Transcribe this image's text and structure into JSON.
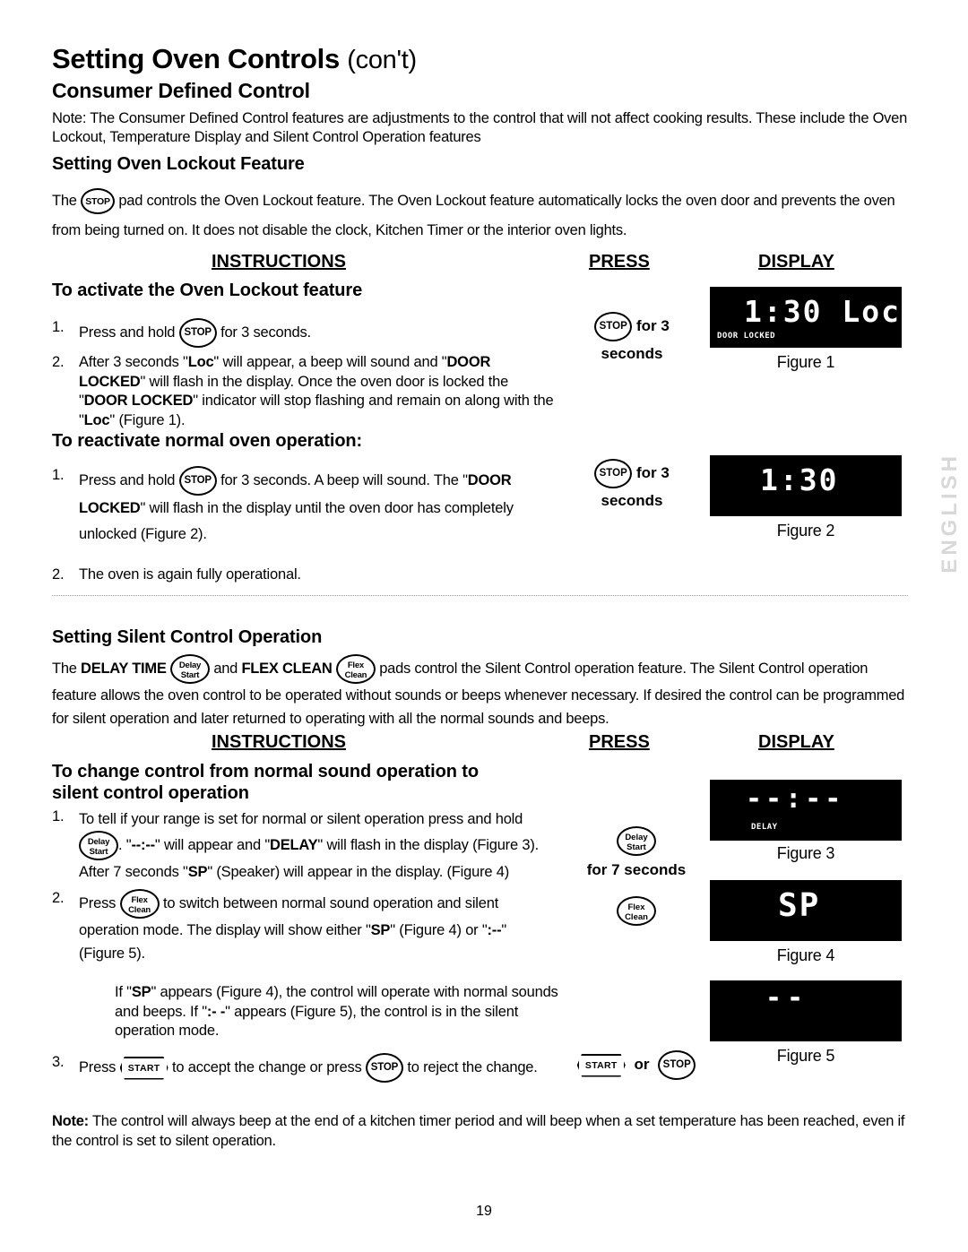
{
  "document": {
    "title_main": "Setting Oven Controls",
    "title_suffix": "(con't)",
    "subtitle": "Consumer Defined Control",
    "page_number": "19",
    "side_marker": "ENGLISH"
  },
  "intro": {
    "note": "Note: The Consumer Defined Control features are adjustments to the control that will not affect cooking results. These include the Oven Lockout, Temperature Display and Silent Control Operation features",
    "section_heading": "Setting Oven Lockout Feature",
    "paragraph_pre": "The",
    "paragraph_post": "pad controls the Oven Lockout feature. The Oven Lockout feature automatically locks the oven door and prevents the oven from being turned on. It does not disable the clock, Kitchen Timer or the interior oven lights."
  },
  "columns": {
    "instructions": "INSTRUCTIONS",
    "press": "PRESS",
    "display": "DISPLAY"
  },
  "pads": {
    "stop": "STOP",
    "start": "START",
    "delay_line1": "Delay",
    "delay_line2": "Start",
    "flex_line1": "Flex",
    "flex_line2": "Clean"
  },
  "lockout": {
    "activate_heading": "To activate the Oven Lockout feature",
    "activate_steps": [
      {
        "num": "1.",
        "pre": "Press and hold",
        "post": "for 3 seconds."
      },
      {
        "num": "2.",
        "pre": "After 3 seconds \"",
        "b1": "Loc",
        "mid1": "\" will appear, a beep will sound and \"",
        "b2": "DOOR LOCKED",
        "mid2": "\" will flash in the display. Once the oven door is locked the \"",
        "b3": "DOOR LOCKED",
        "mid3": "\" indicator will stop flashing and remain on along with the \"",
        "b4": "Loc",
        "post": "\" (Figure 1)."
      }
    ],
    "reactivate_heading": "To reactivate normal oven operation:",
    "reactivate_steps": [
      {
        "num": "1.",
        "pre": "Press and hold",
        "mid1": "for 3 seconds. A beep will sound. The \"",
        "b1": "DOOR LOCKED",
        "post": "\" will flash in the display until the oven door has completely unlocked (Figure 2)."
      },
      {
        "num": "2.",
        "text": "The oven is again fully operational."
      }
    ],
    "press_1_row1_suffix": "for 3",
    "press_1_row2": "seconds",
    "press_2_row1_suffix": "for 3",
    "press_2_row2": "seconds"
  },
  "figures": {
    "fig1": {
      "caption": "Figure 1",
      "digits": "1:30 Loc",
      "indicator": "DOOR LOCKED"
    },
    "fig2": {
      "caption": "Figure 2",
      "digits": "1:30",
      "indicator": ""
    },
    "fig3": {
      "caption": "Figure 3",
      "digits": "--:--",
      "indicator": "DELAY"
    },
    "fig4": {
      "caption": "Figure 4",
      "digits": "SP",
      "indicator": ""
    },
    "fig5": {
      "caption": "Figure 5",
      "digits": "--",
      "indicator": ""
    }
  },
  "silent": {
    "section_heading": "Setting Silent Control Operation",
    "para_p1": "The",
    "para_b1": "DELAY TIME",
    "para_p2": "and",
    "para_b2": "FLEX CLEAN",
    "para_p3": "pads control the Silent Control operation feature. The Silent Control operation feature allows the oven control to be operated without sounds or beeps whenever necessary. If desired the control can be programmed for silent operation and later returned to operating with all the normal sounds and beeps.",
    "change_heading_l1": "To change control from normal sound operation to",
    "change_heading_l2": "silent control operation",
    "steps": [
      {
        "num": "1.",
        "pre": "To tell if your range is set for normal or silent operation press and hold",
        "mid1": ". \"",
        "b1": "--:--",
        "mid2": "\" will appear and \"",
        "b2": "DELAY",
        "mid3": "\" will flash in the display (Figure 3).  After 7 seconds \"",
        "b3": "SP",
        "post": "\" (Speaker) will appear in the display. (Figure 4)"
      },
      {
        "num": "2.",
        "pre": "Press",
        "mid1": "to switch between normal sound operation and silent operation mode. The display will show either \"",
        "b1": "SP",
        "mid2": "\" (Figure 4) or \"",
        "b2": ":--",
        "post": "\" (Figure 5)."
      }
    ],
    "paragraph_extra_pre": "If \"",
    "paragraph_extra_b1": "SP",
    "paragraph_extra_mid": "\" appears (Figure 4), the control will operate with normal sounds and beeps. If \"",
    "paragraph_extra_b2": ":- -",
    "paragraph_extra_post": "\" appears (Figure 5), the control is in the silent operation mode.",
    "step3": {
      "num": "3.",
      "pre": "Press",
      "mid1": "to accept the change or press",
      "post": "to reject the change."
    },
    "press_delay_label": "for 7 seconds",
    "press_or": "or"
  },
  "final_note": {
    "label": "Note:",
    "text": " The control will always beep at the end of a kitchen timer period and will beep when a set temperature has been reached, even if the control is set to silent operation."
  }
}
